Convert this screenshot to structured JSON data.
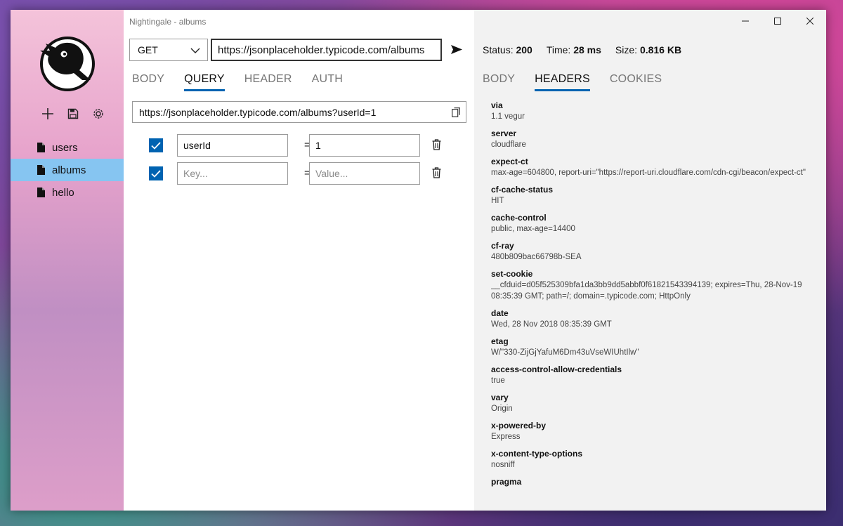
{
  "window": {
    "title": "Nightingale - albums"
  },
  "sidebar": {
    "toolbar": [
      {
        "icon": "plus-icon"
      },
      {
        "icon": "save-icon"
      },
      {
        "icon": "gear-icon"
      }
    ],
    "items": [
      {
        "label": "users",
        "active": false
      },
      {
        "label": "albums",
        "active": true
      },
      {
        "label": "hello",
        "active": false
      }
    ]
  },
  "request": {
    "method": "GET",
    "url": "https://jsonplaceholder.typicode.com/albums",
    "tabs": [
      "BODY",
      "QUERY",
      "HEADER",
      "AUTH"
    ],
    "active_tab": "QUERY",
    "query_url": "https://jsonplaceholder.typicode.com/albums?userId=1",
    "params": [
      {
        "checked": true,
        "key": "userId",
        "value": "1",
        "key_placeholder": "",
        "value_placeholder": ""
      },
      {
        "checked": true,
        "key": "",
        "value": "",
        "key_placeholder": "Key...",
        "value_placeholder": "Value..."
      }
    ],
    "equals": "="
  },
  "response": {
    "status_label": "Status:",
    "status": "200",
    "time_label": "Time:",
    "time": "28 ms",
    "size_label": "Size:",
    "size": "0.816 KB",
    "tabs": [
      "BODY",
      "HEADERS",
      "COOKIES"
    ],
    "active_tab": "HEADERS",
    "headers": [
      {
        "name": "via",
        "value": "1.1 vegur"
      },
      {
        "name": "server",
        "value": "cloudflare"
      },
      {
        "name": "expect-ct",
        "value": "max-age=604800, report-uri=\"https://report-uri.cloudflare.com/cdn-cgi/beacon/expect-ct\""
      },
      {
        "name": "cf-cache-status",
        "value": "HIT"
      },
      {
        "name": "cache-control",
        "value": "public, max-age=14400"
      },
      {
        "name": "cf-ray",
        "value": "480b809bac66798b-SEA"
      },
      {
        "name": "set-cookie",
        "value": "__cfduid=d05f525309bfa1da3bb9dd5abbf0f61821543394139; expires=Thu, 28-Nov-19 08:35:39 GMT; path=/; domain=.typicode.com; HttpOnly"
      },
      {
        "name": "date",
        "value": "Wed, 28 Nov 2018 08:35:39 GMT"
      },
      {
        "name": "etag",
        "value": "W/\"330-ZijGjYafuM6Dm43uVseWIUhtIlw\""
      },
      {
        "name": "access-control-allow-credentials",
        "value": "true"
      },
      {
        "name": "vary",
        "value": "Origin"
      },
      {
        "name": "x-powered-by",
        "value": "Express"
      },
      {
        "name": "x-content-type-options",
        "value": "nosniff"
      },
      {
        "name": "pragma",
        "value": ""
      }
    ]
  },
  "colors": {
    "accent": "#0063b1",
    "selected_nav": "#86c5f1"
  }
}
